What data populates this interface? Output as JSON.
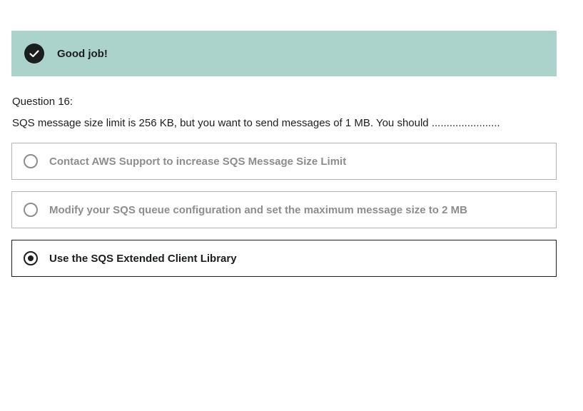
{
  "result_banner": {
    "message": "Good job!",
    "icon": "check-circle-icon",
    "background_color": "#acd2cc"
  },
  "question": {
    "number_label": "Question 16:",
    "text": "SQS message size limit is 256 KB, but you want to send messages of 1 MB. You should ......................."
  },
  "options": [
    {
      "label": "Contact AWS Support to increase SQS Message Size Limit",
      "selected": false
    },
    {
      "label": "Modify your SQS queue configuration and set the maximum message size to 2 MB",
      "selected": false
    },
    {
      "label": "Use the SQS Extended Client Library",
      "selected": true
    }
  ]
}
